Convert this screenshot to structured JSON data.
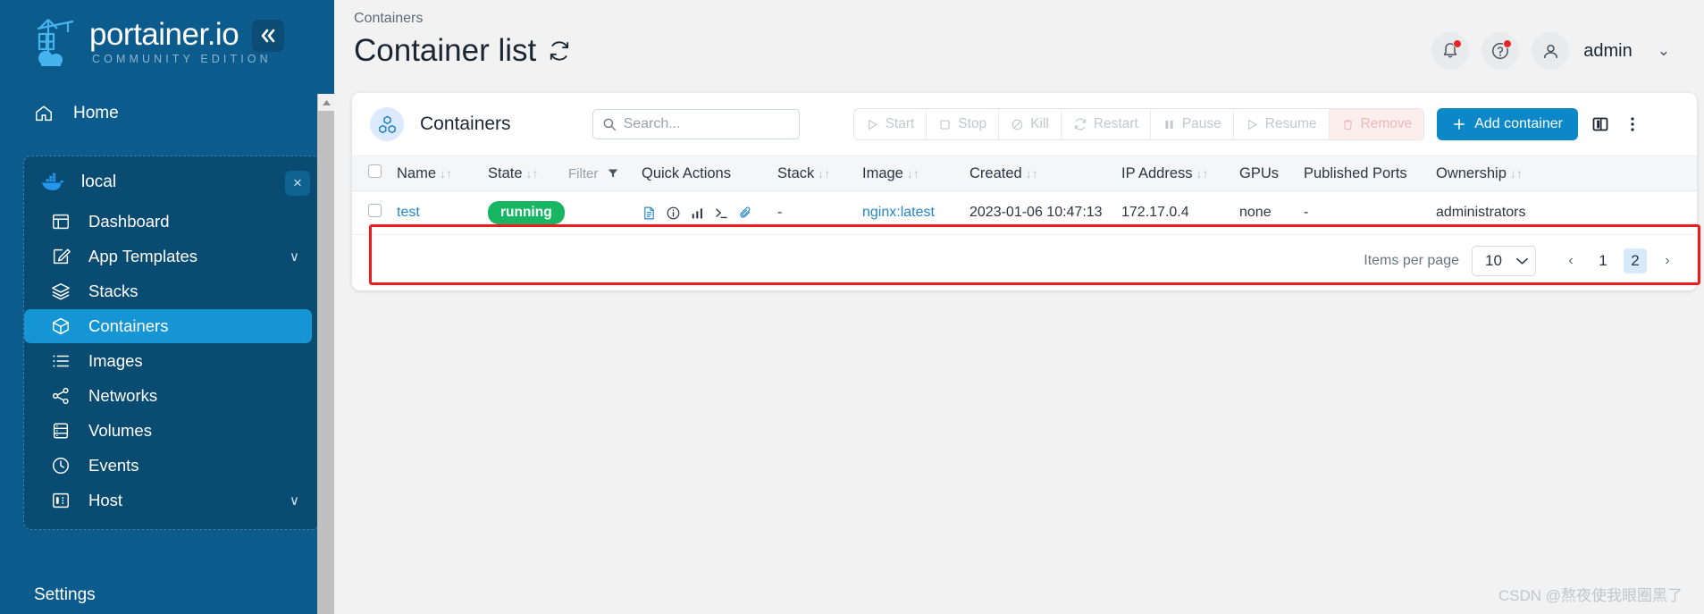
{
  "sidebar": {
    "logo": {
      "title": "portainer.io",
      "subtitle": "COMMUNITY EDITION",
      "icon": "portainer-crane-logo"
    },
    "collapse_icon": "chevron-double-left-icon",
    "home": {
      "label": "Home",
      "icon": "home-icon"
    },
    "environment": {
      "name": "local",
      "icon": "docker-whale-icon",
      "close_icon": "close-icon"
    },
    "items": [
      {
        "label": "Dashboard",
        "icon": "dashboard-icon",
        "active": false,
        "chevron": ""
      },
      {
        "label": "App Templates",
        "icon": "edit-template-icon",
        "active": false,
        "chevron": "∨"
      },
      {
        "label": "Stacks",
        "icon": "layers-icon",
        "active": false,
        "chevron": ""
      },
      {
        "label": "Containers",
        "icon": "container-box-icon",
        "active": true,
        "chevron": ""
      },
      {
        "label": "Images",
        "icon": "list-icon",
        "active": false,
        "chevron": ""
      },
      {
        "label": "Networks",
        "icon": "network-share-icon",
        "active": false,
        "chevron": ""
      },
      {
        "label": "Volumes",
        "icon": "database-icon",
        "active": false,
        "chevron": ""
      },
      {
        "label": "Events",
        "icon": "clock-icon",
        "active": false,
        "chevron": ""
      },
      {
        "label": "Host",
        "icon": "server-icon",
        "active": false,
        "chevron": "∨"
      }
    ],
    "settings_label": "Settings"
  },
  "header": {
    "breadcrumb": "Containers",
    "title": "Container list",
    "refresh_icon": "refresh-icon",
    "notifications_icon": "bell-icon",
    "help_icon": "help-circle-icon",
    "avatar_icon": "user-avatar-icon",
    "user_name": "admin",
    "user_chevron": "chevron-down-icon"
  },
  "card": {
    "icon": "containers-cubes-icon",
    "title": "Containers",
    "search": {
      "placeholder": "Search...",
      "value": "",
      "icon": "search-icon"
    },
    "actions": [
      {
        "label": "Start",
        "icon": "play-icon",
        "state": "disabled"
      },
      {
        "label": "Stop",
        "icon": "square-icon",
        "state": "disabled"
      },
      {
        "label": "Kill",
        "icon": "ban-icon",
        "state": "disabled"
      },
      {
        "label": "Restart",
        "icon": "restart-icon",
        "state": "disabled"
      },
      {
        "label": "Pause",
        "icon": "pause-icon",
        "state": "disabled"
      },
      {
        "label": "Resume",
        "icon": "play-icon",
        "state": "disabled"
      },
      {
        "label": "Remove",
        "icon": "trash-icon",
        "state": "disabled-danger"
      }
    ],
    "add_button": {
      "label": "Add container",
      "icon": "plus-icon"
    },
    "columns_icon": "columns-layout-icon",
    "more_icon": "vertical-dots-icon"
  },
  "table": {
    "select_all_checkbox": "unchecked",
    "columns": [
      {
        "label": "Name",
        "sortable": true
      },
      {
        "label": "State",
        "sortable": true
      },
      {
        "label": "Filter",
        "sortable": false,
        "filter_icon": "funnel-icon"
      },
      {
        "label": "Quick Actions",
        "sortable": false
      },
      {
        "label": "Stack",
        "sortable": true
      },
      {
        "label": "Image",
        "sortable": true
      },
      {
        "label": "Created",
        "sortable": true
      },
      {
        "label": "IP Address",
        "sortable": true
      },
      {
        "label": "GPUs",
        "sortable": false
      },
      {
        "label": "Published Ports",
        "sortable": false
      },
      {
        "label": "Ownership",
        "sortable": true
      }
    ],
    "sort_glyph": "↓↑",
    "rows": [
      {
        "checkbox": "unchecked",
        "name": "test",
        "state": "running",
        "quick_actions": [
          "logs-icon",
          "inspect-info-icon",
          "stats-chart-icon",
          "console-terminal-icon",
          "attach-paperclip-icon"
        ],
        "stack": "-",
        "image": "nginx:latest",
        "created": "2023-01-06 10:47:13",
        "ip_address": "172.17.0.4",
        "gpus": "none",
        "published_ports": "-",
        "ownership": "administrators"
      }
    ]
  },
  "pagination": {
    "items_per_page_label": "Items per page",
    "items_per_page_value": "10",
    "prev_label": "‹",
    "next_label": "›",
    "pages": [
      {
        "label": "1",
        "active": false
      },
      {
        "label": "2",
        "active": true
      }
    ]
  },
  "watermark": "CSDN @熬夜使我眼圈黑了",
  "colors": {
    "sidebar_bg": "#0b5c8d",
    "sidebar_panel": "#0a4b72",
    "nav_active": "#1595d3",
    "accent": "#0c87c8",
    "running_green": "#18b663",
    "highlight_red": "#ee1c1c",
    "link_blue": "#2486c9"
  }
}
